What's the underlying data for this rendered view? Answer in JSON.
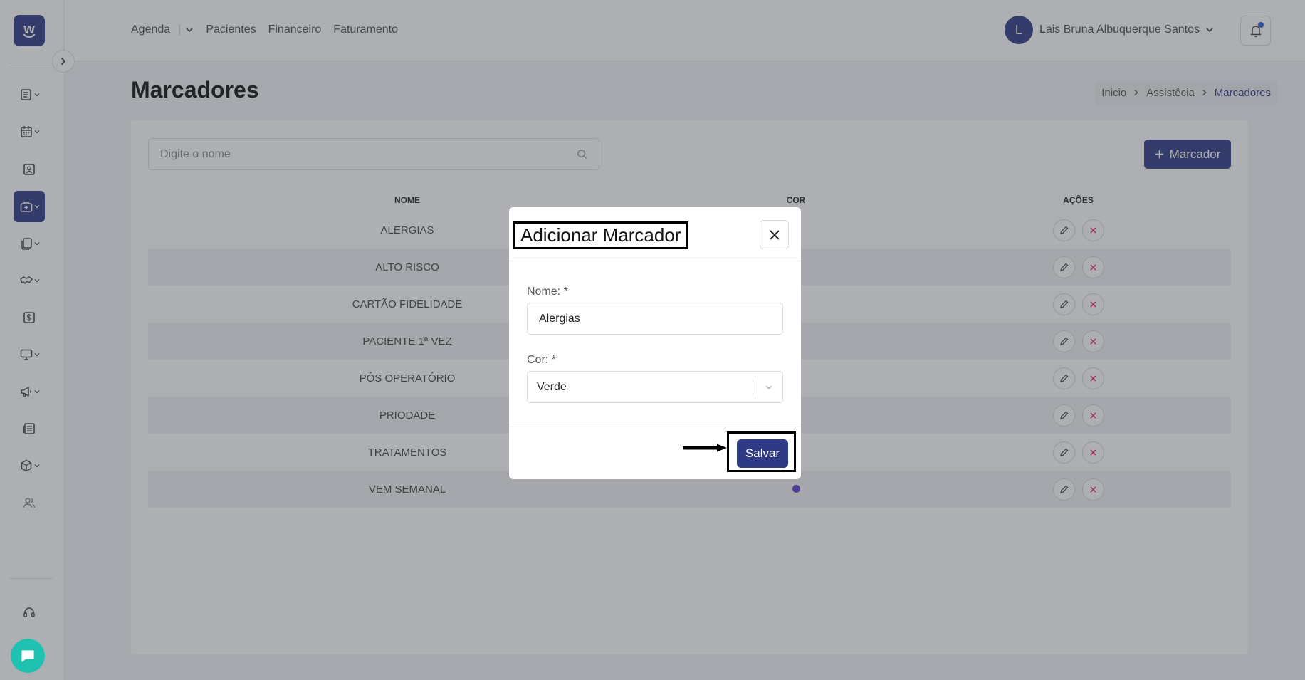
{
  "app": {
    "logo_letter": "w",
    "brand_color": "#2f3a86"
  },
  "sidebar": {
    "items": [
      {
        "icon": "list-icon",
        "has_submenu": true,
        "active": false
      },
      {
        "icon": "calendar-icon",
        "has_submenu": true,
        "active": false
      },
      {
        "icon": "patient-card-icon",
        "has_submenu": false,
        "active": false
      },
      {
        "icon": "medical-bag-icon",
        "has_submenu": true,
        "active": true
      },
      {
        "icon": "documents-icon",
        "has_submenu": true,
        "active": false
      },
      {
        "icon": "handshake-icon",
        "has_submenu": true,
        "active": false
      },
      {
        "icon": "dollar-icon",
        "has_submenu": false,
        "active": false
      },
      {
        "icon": "monitor-icon",
        "has_submenu": true,
        "active": false
      },
      {
        "icon": "megaphone-icon",
        "has_submenu": true,
        "active": false
      },
      {
        "icon": "report-icon",
        "has_submenu": false,
        "active": false
      },
      {
        "icon": "package-icon",
        "has_submenu": true,
        "active": false
      },
      {
        "icon": "users-icon",
        "has_submenu": false,
        "active": false
      }
    ],
    "support_icon": "headset-icon",
    "chat_icon": "chat-icon"
  },
  "topnav": {
    "links": [
      "Agenda",
      "Pacientes",
      "Financeiro",
      "Faturamento"
    ],
    "separator": "|",
    "user": {
      "initial": "L",
      "name": "Lais Bruna Albuquerque Santos"
    },
    "notification_icon": "bell-icon"
  },
  "page": {
    "title": "Marcadores",
    "breadcrumb": [
      "Inicio",
      "Assistêcia",
      "Marcadores"
    ]
  },
  "toolbar": {
    "search_placeholder": "Digite o nome",
    "add_button_label": "Marcador"
  },
  "table": {
    "headers": [
      "NOME",
      "COR",
      "AÇÕES"
    ],
    "rows": [
      {
        "name": "ALERGIAS",
        "color": null
      },
      {
        "name": "ALTO RISCO",
        "color": null
      },
      {
        "name": "CARTÃO FIDELIDADE",
        "color": null
      },
      {
        "name": "PACIENTE 1ª VEZ",
        "color": null
      },
      {
        "name": "PÓS OPERATÓRIO",
        "color": null
      },
      {
        "name": "PRIODADE",
        "color": null
      },
      {
        "name": "TRATAMENTOS",
        "color": null
      },
      {
        "name": "VEM SEMANAL",
        "color": "#5b3fd1"
      }
    ]
  },
  "modal": {
    "title": "Adicionar Marcador",
    "name_label": "Nome: *",
    "name_value": "Alergias",
    "color_label": "Cor: *",
    "color_value": "Verde",
    "save_label": "Salvar"
  }
}
